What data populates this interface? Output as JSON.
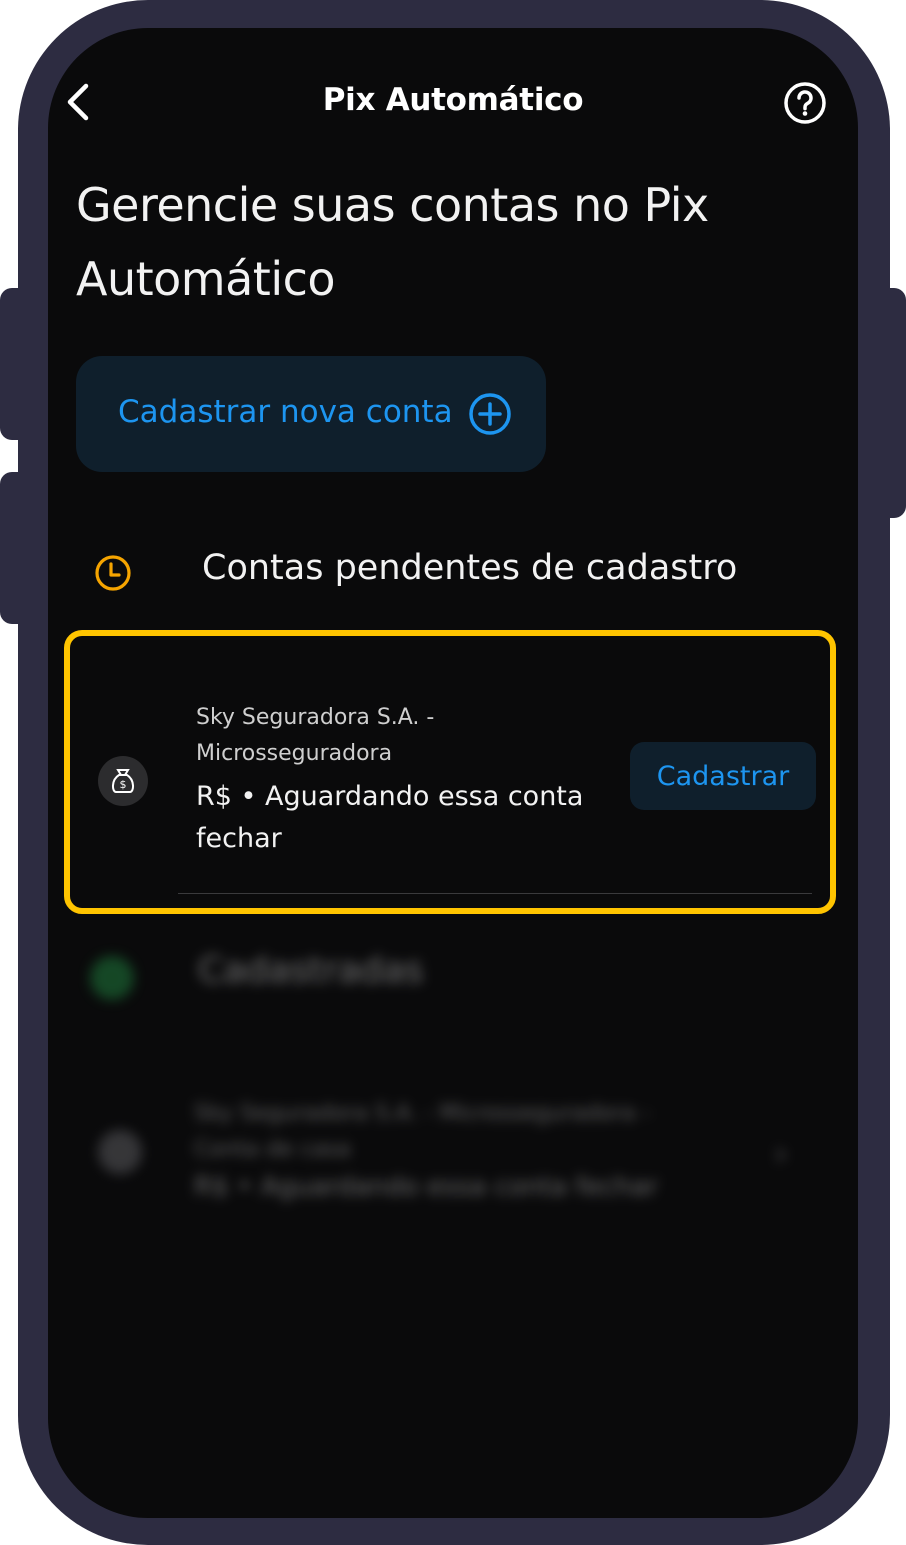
{
  "header": {
    "title": "Pix Automático",
    "back_icon": "chevron-left-icon",
    "help_icon": "help-circle-icon"
  },
  "headline": "Gerencie suas contas no Pix Automático",
  "new_account": {
    "label": "Cadastrar nova conta",
    "icon": "plus-circle-icon"
  },
  "pending": {
    "section_title": "Contas pendentes de cadastro",
    "icon": "clock-icon",
    "items": [
      {
        "company": "Sky Seguradora S.A. - Microsseguradora",
        "status": "R$ • Aguardando essa conta fechar",
        "action": "Cadastrar",
        "icon": "money-bag-icon"
      }
    ]
  },
  "registered": {
    "section_title": "Cadastradas",
    "items": [
      {
        "company": "Sky Seguradora S.A. - Microsseguradora - Conta de casa",
        "status": "R$ • Aguardando essa conta fechar"
      }
    ]
  },
  "colors": {
    "accent": "#1d95f0",
    "highlight": "#ffc400",
    "clock": "#f5a400",
    "frame": "#2d2c41",
    "background": "#0a0a0b"
  }
}
